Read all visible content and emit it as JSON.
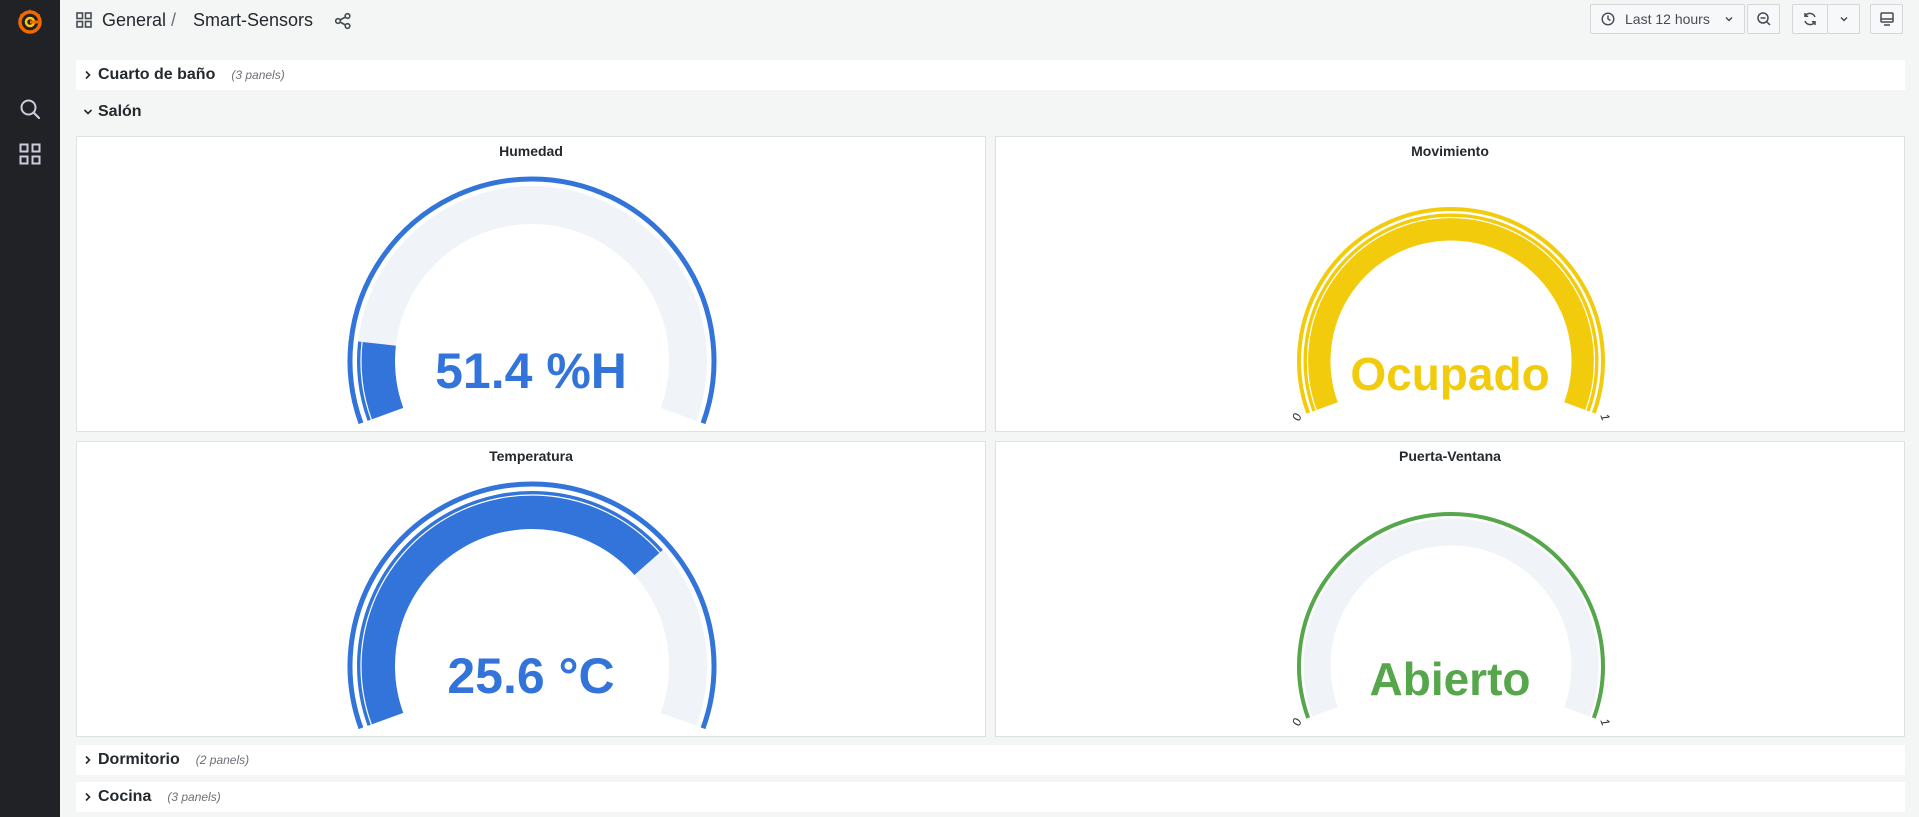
{
  "breadcrumb": {
    "folder": "General",
    "separator": "/",
    "dashboard": "Smart-Sensors"
  },
  "toolbar": {
    "time_range": "Last 12 hours"
  },
  "rows": [
    {
      "title": "Cuarto de baño",
      "count": "(3 panels)",
      "collapsed": true
    },
    {
      "title": "Salón",
      "collapsed": false
    },
    {
      "title": "Dormitorio",
      "count": "(2 panels)",
      "collapsed": true
    },
    {
      "title": "Cocina",
      "count": "(3 panels)",
      "collapsed": true
    }
  ],
  "panels": [
    {
      "title": "Humedad",
      "value": "51.4 %H",
      "color": "#3274d9",
      "fill_fraction": 0.12,
      "threshold_color": "#3274d9"
    },
    {
      "title": "Movimiento",
      "value": "Ocupado",
      "color": "#f2cc0c",
      "fill_fraction": 1.0,
      "min_label": "0",
      "max_label": "1",
      "threshold_color": "#f2cc0c"
    },
    {
      "title": "Temperatura",
      "value": "25.6 °C",
      "color": "#3274d9",
      "fill_fraction": 0.72,
      "threshold_color": "#3274d9"
    },
    {
      "title": "Puerta-Ventana",
      "value": "Abierto",
      "color": "#56a64b",
      "fill_fraction": 0.0,
      "min_label": "0",
      "max_label": "1",
      "threshold_color": "#56a64b"
    }
  ],
  "colors": {
    "sidebar": "#202226",
    "track": "#f0f3f7",
    "logo": "#f46800"
  }
}
